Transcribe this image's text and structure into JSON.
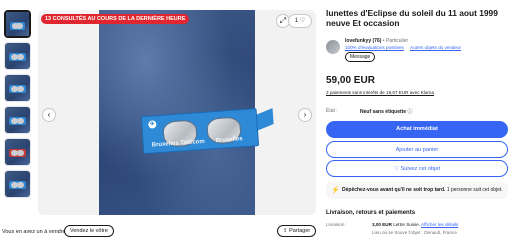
{
  "gallery": {
    "badge": "13 CONSULTÉS AU COURS DE LA DERNIÈRE HEURE",
    "watch_count": "1",
    "prev_icon": "chevron-left-icon",
    "next_icon": "chevron-right-icon",
    "expand_icon": "expand-icon",
    "heart_icon": "heart-icon",
    "glasses_text_left": "Bruxelles Télécom",
    "glasses_text_right": "Bruxelles"
  },
  "footer": {
    "question": "Vous en avez un à vendre ?",
    "sell_label": "Vendez le vôtre",
    "share_label": "Partager"
  },
  "listing": {
    "title": "lunettes d'Eclipse du soleil du 11 aout 1999 neuve Et occasion",
    "price": "59,00 EUR",
    "klarna": "3 paiements sans intérêts de 19,67 EUR avec Klarna"
  },
  "seller": {
    "name": "lovefunkyy (76)",
    "type": "Particulier",
    "rating": "100% d'évaluations positives",
    "other_items": "Autres objets du vendeur",
    "message_label": "Message"
  },
  "condition": {
    "label": "État :",
    "value": "Neuf sans étiquette"
  },
  "actions": {
    "buy_label": "Achat immédiat",
    "cart_label": "Ajouter au panier",
    "follow_label": "Suivez cet objet"
  },
  "urgency": {
    "bold": "Dépêchez-vous avant qu'il ne soit trop tard.",
    "rest": " 1 personne suit cet objet."
  },
  "shipping": {
    "title": "Livraison, retours et paiements",
    "label": "Livraison :",
    "value": "3,00 EUR",
    "method": " Lettre Suivie.",
    "link": "Afficher les détails",
    "location": "Lieu où se trouve l'objet : Denault, France"
  }
}
